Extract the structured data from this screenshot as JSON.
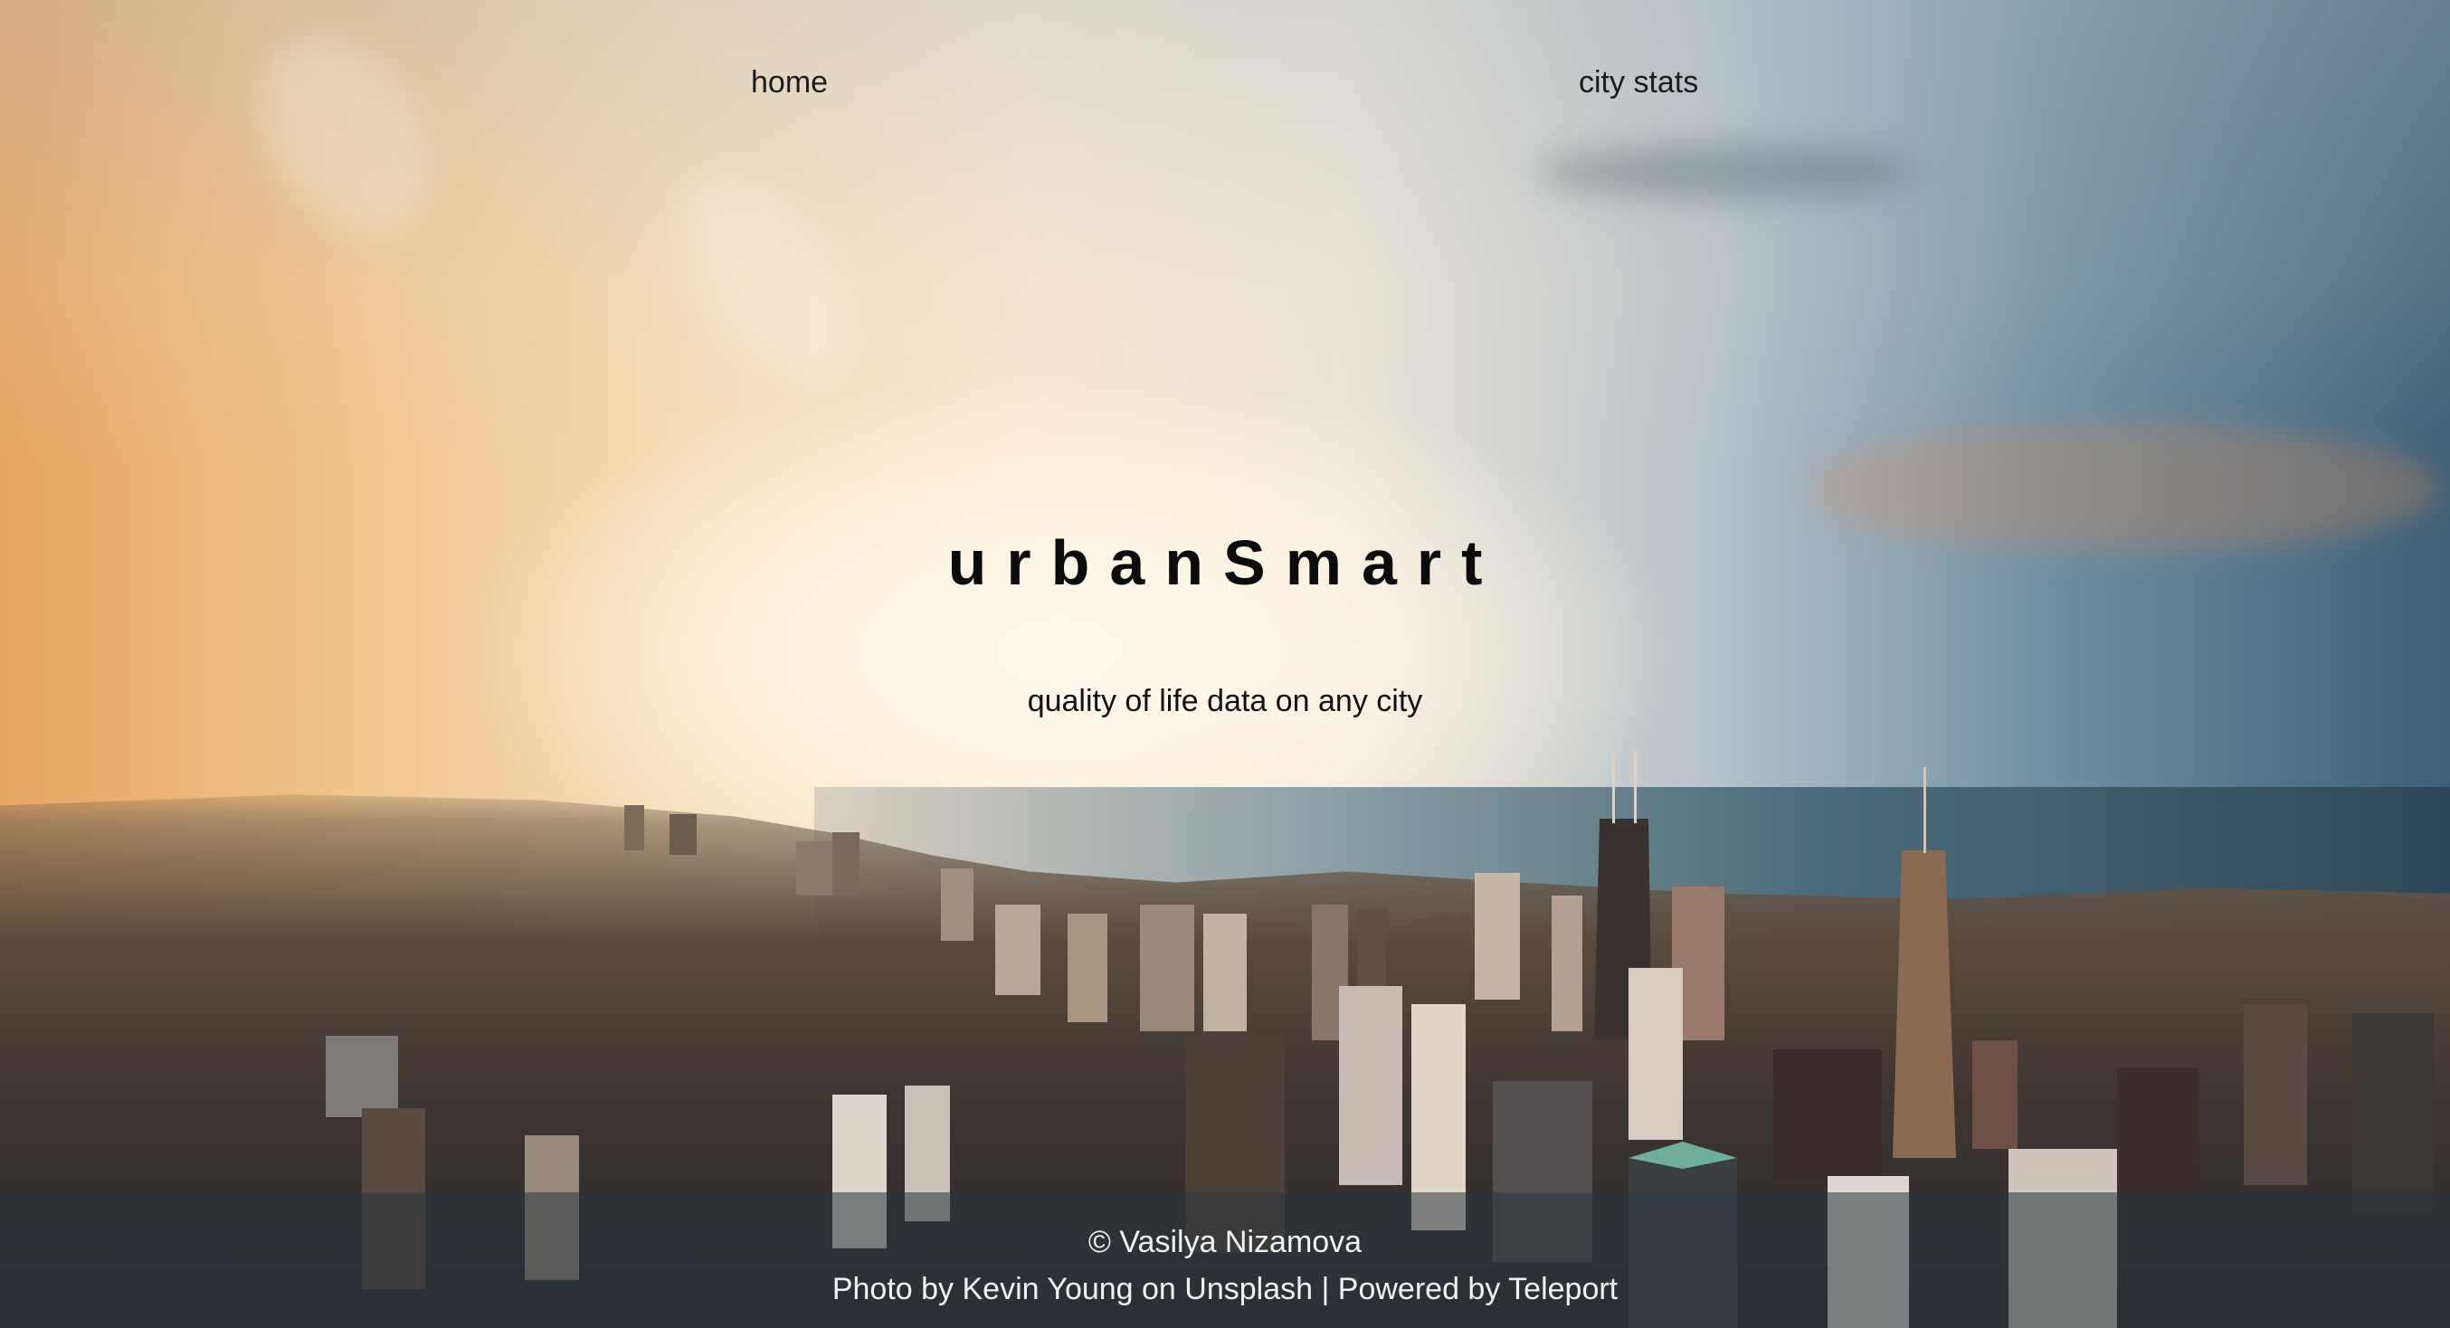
{
  "nav": {
    "home_label": "home",
    "stats_label": "city stats"
  },
  "hero": {
    "title": "urbanSmart",
    "subtitle": "quality of life data on any city"
  },
  "footer": {
    "copyright": "© Vasilya Nizamova",
    "photo_credit_prefix": "Photo by ",
    "photographer": "Kevin Young",
    "photo_credit_middle": " on ",
    "photo_source": "Unsplash",
    "separator": " | ",
    "powered_prefix": "Powered by ",
    "powered_by": "Teleport"
  },
  "colors": {
    "title_text": "#0b0b0b",
    "footer_text": "#f2f2f2",
    "footer_bar": "rgba(40,52,62,0.55)"
  }
}
